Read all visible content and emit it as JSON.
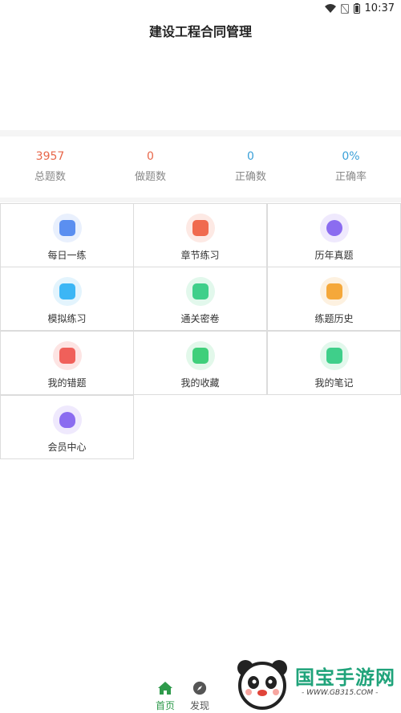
{
  "status_bar": {
    "time": "10:37"
  },
  "app": {
    "title": "建设工程合同管理"
  },
  "stats": [
    {
      "value": "3957",
      "label": "总题数",
      "color": "#e8674a"
    },
    {
      "value": "0",
      "label": "做题数",
      "color": "#e8674a"
    },
    {
      "value": "0",
      "label": "正确数",
      "color": "#3aa0d8"
    },
    {
      "value": "0%",
      "label": "正确率",
      "color": "#3aa0d8"
    }
  ],
  "menu": [
    {
      "label": "每日一练",
      "icon": "daily-practice-icon",
      "color": "#5b8ff0",
      "bg": "#e9f0fd"
    },
    {
      "label": "章节练习",
      "icon": "chapter-practice-icon",
      "color": "#f06a4e",
      "bg": "#fde9e4"
    },
    {
      "label": "历年真题",
      "icon": "past-exams-icon",
      "color": "#8b6cf0",
      "bg": "#efe9fd"
    },
    {
      "label": "模拟练习",
      "icon": "mock-practice-icon",
      "color": "#3cb6f5",
      "bg": "#e3f4fd"
    },
    {
      "label": "通关密卷",
      "icon": "secret-paper-icon",
      "color": "#3fcf8a",
      "bg": "#e2f8ec"
    },
    {
      "label": "练题历史",
      "icon": "history-icon",
      "color": "#f5a83a",
      "bg": "#fdf1e0"
    },
    {
      "label": "我的错题",
      "icon": "wrong-questions-icon",
      "color": "#f0605a",
      "bg": "#fde4e3"
    },
    {
      "label": "我的收藏",
      "icon": "favorites-icon",
      "color": "#3fcf7a",
      "bg": "#e2f8ea"
    },
    {
      "label": "我的笔记",
      "icon": "notes-icon",
      "color": "#3fcf8a",
      "bg": "#e2f8ec"
    },
    {
      "label": "会员中心",
      "icon": "vip-heart-icon",
      "color": "#8b6cf0",
      "bg": "#efe9fd"
    }
  ],
  "tabs": [
    {
      "label": "首页",
      "icon": "home-icon",
      "active": true,
      "color": "#2e9a4b"
    },
    {
      "label": "发现",
      "icon": "compass-icon",
      "active": false,
      "color": "#555555"
    }
  ],
  "watermark": {
    "text": "国宝手游网",
    "sub": "- WWW.GB315.COM -"
  }
}
